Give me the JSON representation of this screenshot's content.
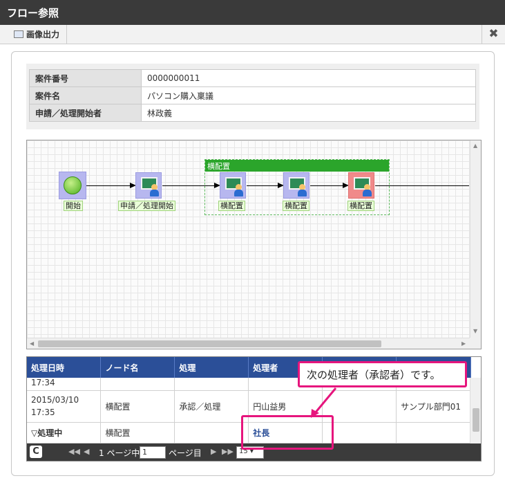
{
  "window": {
    "title": "フロー参照"
  },
  "toolbar": {
    "export_label": "画像出力",
    "close_glyph": "✖"
  },
  "info": {
    "rows": [
      {
        "label": "案件番号",
        "value": "0000000011"
      },
      {
        "label": "案件名",
        "value": "パソコン購入稟議"
      },
      {
        "label": "申請／処理開始者",
        "value": "林政義"
      }
    ]
  },
  "diagram": {
    "lane_title": "横配置",
    "nodes": [
      {
        "label": "開始",
        "kind": "start"
      },
      {
        "label": "申請／処理開始",
        "kind": "task"
      },
      {
        "label": "横配置",
        "kind": "task"
      },
      {
        "label": "横配置",
        "kind": "task"
      },
      {
        "label": "横配置",
        "kind": "task-current"
      }
    ],
    "scroll_glyphs": {
      "up": "▲",
      "down": "▼",
      "left": "◀",
      "right": "▶"
    }
  },
  "history": {
    "columns": [
      "処理日時",
      "ノード名",
      "処理",
      "処理者",
      "",
      ""
    ],
    "rows": [
      {
        "date": "17:34",
        "node": "",
        "action": "",
        "actor": "",
        "col5": "",
        "col6": ""
      },
      {
        "date": "2015/03/10\n17:35",
        "node": "横配置",
        "action": "承認／処理",
        "actor": "円山益男",
        "col5": "",
        "col6": "サンプル部門01"
      },
      {
        "date": "▽処理中",
        "node": "横配置",
        "action": "",
        "actor": "社長",
        "col5": "",
        "col6": ""
      }
    ]
  },
  "pager": {
    "first": "◀◀",
    "prev": "◀",
    "page_prefix": "1 ページ中",
    "page_value": "1",
    "page_suffix": "ページ目",
    "next": "▶",
    "last": "▶▶",
    "page_size": "15 ▾",
    "refresh_glyph": "C"
  },
  "annotation": {
    "callout_text": "次の処理者（承認者）です。"
  },
  "colors": {
    "grid_header": "#2b4f98",
    "lane": "#2ba52b",
    "highlight": "#e6157d",
    "title_bar": "#3a3a3a"
  }
}
